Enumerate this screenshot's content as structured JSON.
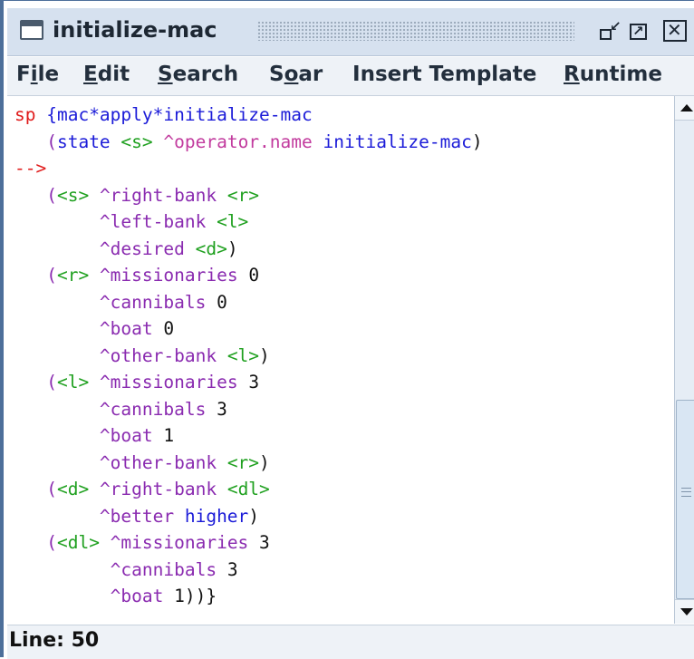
{
  "window": {
    "title": "initialize-mac",
    "buttons": {
      "iconify_icon": "iconify-icon",
      "maximize_icon": "maximize-icon",
      "close_icon": "close-icon"
    }
  },
  "menubar": {
    "items": [
      {
        "label": "File",
        "mnemonic_index": 1
      },
      {
        "label": "Edit",
        "mnemonic_index": 0
      },
      {
        "label": "Search",
        "mnemonic_index": 0
      },
      {
        "label": "Soar",
        "mnemonic_index": 1
      },
      {
        "label": "Insert Template",
        "mnemonic_index": -1
      },
      {
        "label": "Runtime",
        "mnemonic_index": 0
      }
    ]
  },
  "editor": {
    "lines": [
      [
        {
          "t": "sp ",
          "c": "red"
        },
        {
          "t": "{mac*apply*initialize-mac",
          "c": "blue"
        }
      ],
      [
        {
          "t": "   (",
          "c": "purple"
        },
        {
          "t": "state ",
          "c": "blue"
        },
        {
          "t": "<s>",
          "c": "green"
        },
        {
          "t": " ^operator.name ",
          "c": "pink"
        },
        {
          "t": "initialize-mac",
          "c": "blue"
        },
        {
          "t": ")",
          "c": "black"
        }
      ],
      [
        {
          "t": "-->",
          "c": "red"
        }
      ],
      [
        {
          "t": "   (",
          "c": "purple"
        },
        {
          "t": "<s>",
          "c": "green"
        },
        {
          "t": " ^right-bank ",
          "c": "purple"
        },
        {
          "t": "<r>",
          "c": "green"
        }
      ],
      [
        {
          "t": "        ^left-bank ",
          "c": "purple"
        },
        {
          "t": "<l>",
          "c": "green"
        }
      ],
      [
        {
          "t": "        ^desired ",
          "c": "purple"
        },
        {
          "t": "<d>",
          "c": "green"
        },
        {
          "t": ")",
          "c": "black"
        }
      ],
      [
        {
          "t": "   (",
          "c": "purple"
        },
        {
          "t": "<r>",
          "c": "green"
        },
        {
          "t": " ^missionaries ",
          "c": "purple"
        },
        {
          "t": "0",
          "c": "black"
        }
      ],
      [
        {
          "t": "        ^cannibals ",
          "c": "purple"
        },
        {
          "t": "0",
          "c": "black"
        }
      ],
      [
        {
          "t": "        ^boat ",
          "c": "purple"
        },
        {
          "t": "0",
          "c": "black"
        }
      ],
      [
        {
          "t": "        ^other-bank ",
          "c": "purple"
        },
        {
          "t": "<l>",
          "c": "green"
        },
        {
          "t": ")",
          "c": "black"
        }
      ],
      [
        {
          "t": "   (",
          "c": "purple"
        },
        {
          "t": "<l>",
          "c": "green"
        },
        {
          "t": " ^missionaries ",
          "c": "purple"
        },
        {
          "t": "3",
          "c": "black"
        }
      ],
      [
        {
          "t": "        ^cannibals ",
          "c": "purple"
        },
        {
          "t": "3",
          "c": "black"
        }
      ],
      [
        {
          "t": "        ^boat ",
          "c": "purple"
        },
        {
          "t": "1",
          "c": "black"
        }
      ],
      [
        {
          "t": "        ^other-bank ",
          "c": "purple"
        },
        {
          "t": "<r>",
          "c": "green"
        },
        {
          "t": ")",
          "c": "black"
        }
      ],
      [
        {
          "t": "   (",
          "c": "purple"
        },
        {
          "t": "<d>",
          "c": "green"
        },
        {
          "t": " ^right-bank ",
          "c": "purple"
        },
        {
          "t": "<dl>",
          "c": "green"
        }
      ],
      [
        {
          "t": "        ^better ",
          "c": "purple"
        },
        {
          "t": "higher",
          "c": "blue"
        },
        {
          "t": ")",
          "c": "black"
        }
      ],
      [
        {
          "t": "   (",
          "c": "purple"
        },
        {
          "t": "<dl>",
          "c": "green"
        },
        {
          "t": " ^missionaries ",
          "c": "purple"
        },
        {
          "t": "3",
          "c": "black"
        }
      ],
      [
        {
          "t": "         ^cannibals ",
          "c": "purple"
        },
        {
          "t": "3",
          "c": "black"
        }
      ],
      [
        {
          "t": "         ^boat ",
          "c": "purple"
        },
        {
          "t": "1))}",
          "c": "black"
        }
      ]
    ]
  },
  "scrollbar": {
    "position_fraction": 0.72
  },
  "status": {
    "text": "Line: 50"
  },
  "colors": {
    "keyword_red": "#e01b1b",
    "name_blue": "#1b1bd8",
    "attr_purple": "#8a2bb0",
    "var_green": "#1fa01f",
    "titlebar": "#d6e1ef",
    "frame": "#4d6f9a"
  }
}
